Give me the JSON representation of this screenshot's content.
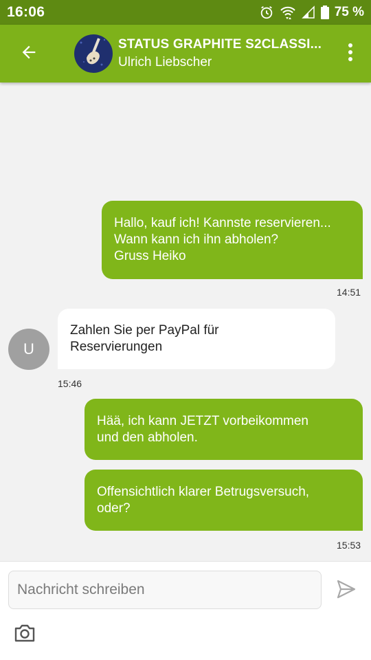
{
  "status_bar": {
    "time": "16:06",
    "battery": "75 %",
    "icons": [
      "alarm-icon",
      "wifi-icon",
      "signal-icon",
      "battery-icon"
    ]
  },
  "header": {
    "title": "STATUS GRAPHITE S2CLASSI...",
    "subtitle": "Ulrich Liebscher",
    "icons": [
      "back-arrow-icon",
      "more-vert-icon"
    ]
  },
  "messages": [
    {
      "direction": "out",
      "text": "Hallo, kauf ich! Kannste reservieren...\nWann kann ich ihn abholen?\nGruss Heiko"
    },
    {
      "direction": "in",
      "text": "Zahlen Sie per PayPal für\nReservierungen"
    },
    {
      "direction": "out",
      "text": "Hää, ich kann JETZT vorbeikommen\nund den abholen."
    },
    {
      "direction": "out",
      "text": "Offensichtlich klarer Betrugsversuch,\noder?"
    }
  ],
  "timestamps": [
    "14:51",
    "15:46",
    "15:53"
  ],
  "partner_initial": "U",
  "composer": {
    "placeholder": "Nachricht schreiben",
    "icons": [
      "send-icon",
      "camera-icon"
    ]
  },
  "colors": {
    "status_bar": "#5e8a12",
    "app_bar": "#7eb21a",
    "outgoing_bubble": "#80b61a",
    "incoming_bubble": "#ffffff",
    "chat_background": "#f2f2f2"
  }
}
